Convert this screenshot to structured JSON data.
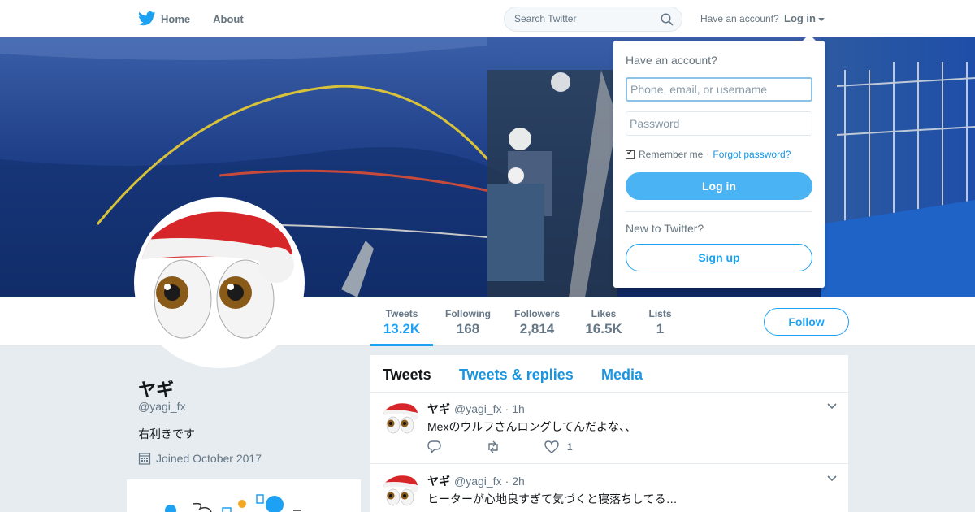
{
  "nav": {
    "home_label": "Home",
    "about_label": "About",
    "search_placeholder": "Search Twitter",
    "account_text": "Have an account?",
    "login_label": "Log in"
  },
  "colors": {
    "accent": "#1da1f2",
    "link": "#1b95e0",
    "login_button": "#4ab3f4"
  },
  "profile": {
    "name": "ヤギ",
    "handle": "@yagi_fx",
    "bio": "右利きです",
    "joined": "Joined October 2017"
  },
  "stats": [
    {
      "label": "Tweets",
      "value": "13.2K"
    },
    {
      "label": "Following",
      "value": "168"
    },
    {
      "label": "Followers",
      "value": "2,814"
    },
    {
      "label": "Likes",
      "value": "16.5K"
    },
    {
      "label": "Lists",
      "value": "1"
    }
  ],
  "follow_label": "Follow",
  "timeline": {
    "tabs": [
      "Tweets",
      "Tweets & replies",
      "Media"
    ],
    "tweets": [
      {
        "name": "ヤギ",
        "handle": "@yagi_fx",
        "time": "1h",
        "text": "Mexのウルフさんロングしてんだよな、、",
        "likes": "1"
      },
      {
        "name": "ヤギ",
        "handle": "@yagi_fx",
        "time": "2h",
        "text": "ヒーターが心地良すぎて気づくと寝落ちしてる…",
        "likes": ""
      }
    ]
  },
  "dropdown": {
    "heading": "Have an account?",
    "username_placeholder": "Phone, email, or username",
    "password_placeholder": "Password",
    "remember_label": "Remember me",
    "separator": "·",
    "forgot_label": "Forgot password?",
    "login_button": "Log in",
    "new_label": "New to Twitter?",
    "signup_button": "Sign up"
  }
}
